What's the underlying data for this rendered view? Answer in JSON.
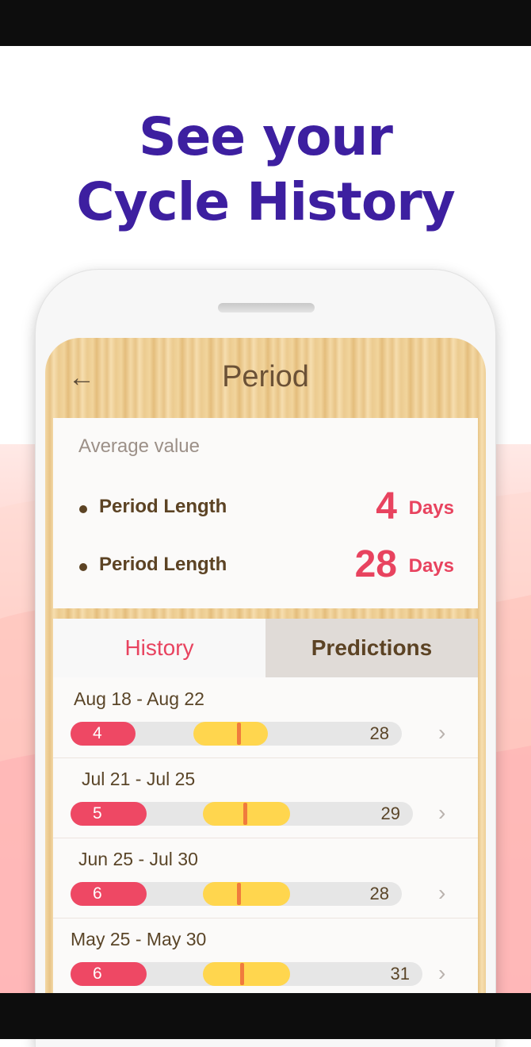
{
  "headline": {
    "line1": "See your",
    "line2": "Cycle History"
  },
  "app": {
    "title": "Period",
    "back_icon": "arrow-left-icon"
  },
  "average": {
    "label": "Average value",
    "stats": [
      {
        "name": "Period Length",
        "value": "4",
        "unit": "Days"
      },
      {
        "name": "Period Length",
        "value": "28",
        "unit": "Days"
      }
    ]
  },
  "tabs": {
    "history": "History",
    "predictions": "Predictions",
    "active": "History"
  },
  "cycles": [
    {
      "dates": "Aug 18 - Aug 22",
      "period_days": "4",
      "cycle_length": "28"
    },
    {
      "dates": "Jul 21 - Jul 25",
      "period_days": "5",
      "cycle_length": "29"
    },
    {
      "dates": "Jun 25 - Jul 30",
      "period_days": "6",
      "cycle_length": "28"
    },
    {
      "dates": "May 25 - May 30",
      "period_days": "6",
      "cycle_length": "31"
    }
  ],
  "colors": {
    "headline": "#3d1fa0",
    "accent": "#e8435f",
    "fertile": "#ffd64e",
    "ovulation": "#f07b3d",
    "text_brown": "#5c4324"
  }
}
